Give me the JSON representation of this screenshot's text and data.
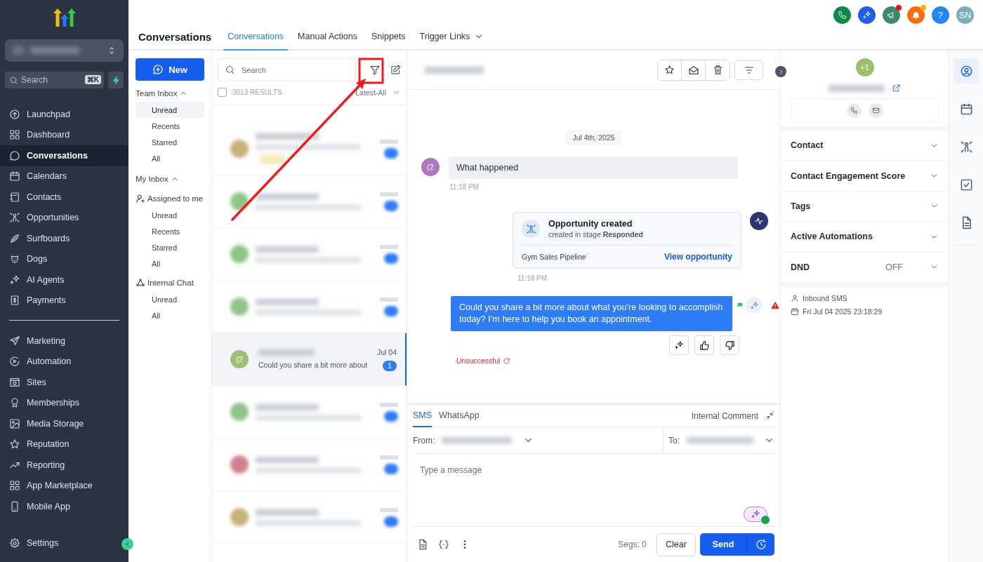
{
  "sidebar": {
    "search": {
      "placeholder": "Search",
      "shortcut": "⌘K"
    },
    "nav": [
      [
        {
          "label": "Launchpad",
          "selected": false
        },
        {
          "label": "Dashboard",
          "selected": false
        },
        {
          "label": "Conversations",
          "selected": true
        },
        {
          "label": "Calendars",
          "selected": false
        },
        {
          "label": "Contacts",
          "selected": false
        },
        {
          "label": "Opportunities",
          "selected": false
        },
        {
          "label": "Surfboards",
          "selected": false
        },
        {
          "label": "Dogs",
          "selected": false
        },
        {
          "label": "AI Agents",
          "selected": false
        },
        {
          "label": "Payments",
          "selected": false
        }
      ],
      [
        {
          "label": "Marketing",
          "selected": false
        },
        {
          "label": "Automation",
          "selected": false
        },
        {
          "label": "Sites",
          "selected": false
        },
        {
          "label": "Memberships",
          "selected": false
        },
        {
          "label": "Media Storage",
          "selected": false
        },
        {
          "label": "Reputation",
          "selected": false
        },
        {
          "label": "Reporting",
          "selected": false
        },
        {
          "label": "App Marketplace",
          "selected": false
        },
        {
          "label": "Mobile App",
          "selected": false
        }
      ]
    ],
    "settings": "Settings"
  },
  "header": {
    "title": "Conversations",
    "tabs": [
      {
        "label": "Conversations",
        "selected": true,
        "dropdown": false
      },
      {
        "label": "Manual Actions",
        "selected": false,
        "dropdown": false
      },
      {
        "label": "Snippets",
        "selected": false,
        "dropdown": false
      },
      {
        "label": "Trigger Links",
        "selected": false,
        "dropdown": true
      }
    ]
  },
  "top_bar": [
    {
      "kind": "phone"
    },
    {
      "kind": "sparkle"
    },
    {
      "kind": "megaphone",
      "color": "#e5121b"
    },
    {
      "kind": "bell",
      "color": "#f5b400"
    },
    {
      "kind": "help",
      "label": "?"
    },
    {
      "kind": "avatar",
      "label": "SN"
    }
  ],
  "inbox": {
    "new_button": "New",
    "sections": [
      {
        "kind": "heading",
        "label": "Team Inbox",
        "expanded": true,
        "children": [
          {
            "label": "Unread",
            "selected": true
          },
          {
            "label": "Recents",
            "selected": false
          },
          {
            "label": "Starred",
            "selected": false
          },
          {
            "label": "All",
            "selected": false
          }
        ]
      },
      {
        "kind": "heading",
        "label": "My Inbox",
        "expanded": true,
        "children": [
          {
            "kind": "person",
            "label": "Assigned to me",
            "children": [
              {
                "label": "Unread",
                "selected": false
              },
              {
                "label": "Recents",
                "selected": false
              },
              {
                "label": "Starred",
                "selected": false
              },
              {
                "label": "All",
                "selected": false
              }
            ]
          }
        ]
      },
      {
        "kind": "network",
        "label": "Internal Chat",
        "children": [
          {
            "label": "Unread",
            "selected": false
          },
          {
            "label": "All",
            "selected": false
          }
        ]
      }
    ]
  },
  "list": {
    "search_placeholder": "Search",
    "select_all_checked": false,
    "results": "3013 RESULTS",
    "sort": "Latest-All",
    "conversations": [
      {
        "kind": "blurred",
        "color": "#c9b27a",
        "tag": true,
        "selected": false
      },
      {
        "kind": "blurred",
        "color": "#8fc587",
        "tag": false,
        "selected": false
      },
      {
        "kind": "blurred",
        "color": "#8fc587",
        "tag": false,
        "selected": false
      },
      {
        "kind": "blurred",
        "color": "#8fc587",
        "tag": false,
        "selected": false
      },
      {
        "kind": "message",
        "color": "#9dc173",
        "avatar": "(2",
        "preview": "Could you share a bit more about",
        "date": "Jul 04",
        "unread": "1",
        "selected": true
      },
      {
        "kind": "blurred",
        "color": "#8fc587",
        "tag": false,
        "selected": false
      },
      {
        "kind": "blurred",
        "color": "#d0808e",
        "tag": false,
        "selected": false
      },
      {
        "kind": "blurred",
        "color": "#c9b27a",
        "tag": false,
        "selected": false
      }
    ]
  },
  "chat": {
    "date": "Jul 4th, 2025",
    "messages": [
      {
        "kind": "inbound",
        "avatar": "(2",
        "text": "What happened",
        "time": "11:18 PM"
      },
      {
        "kind": "activity",
        "title": "Opportunity created",
        "subtitle": "created in stage **Responded**",
        "pipeline": "Gym Sales Pipeline",
        "link": "View opportunity",
        "time": "11:18 PM"
      },
      {
        "kind": "outbound",
        "text": "Could you share a bit more about what you’re looking to accomplish today? I’m here to help you book an appointment.",
        "status": "Unsuccessful",
        "failed": true
      }
    ]
  },
  "composer": {
    "channels": [
      {
        "label": "SMS",
        "selected": true
      },
      {
        "label": "WhatsApp",
        "selected": false
      }
    ],
    "internal_comment": "Internal Comment",
    "from_label": "From:",
    "to_label": "To:",
    "placeholder": "Type a message",
    "segments": "Segs: 0",
    "clear": "Clear",
    "send": "Send"
  },
  "contact": {
    "avatar": "+1",
    "sections": [
      {
        "label": "Contact",
        "expanded": false
      },
      {
        "label": "Contact Engagement Score",
        "expanded": false
      },
      {
        "label": "Tags",
        "expanded": false
      },
      {
        "label": "Active Automations",
        "expanded": false
      },
      {
        "label": "DND",
        "value": "OFF",
        "expanded": false
      }
    ],
    "source": "Inbound SMS",
    "timestamp": "Fri Jul 04 2025 23:18:29"
  },
  "rail": [
    {
      "selected": true
    },
    {
      "selected": false
    },
    {
      "selected": false
    },
    {
      "selected": false
    },
    {
      "selected": false
    }
  ]
}
